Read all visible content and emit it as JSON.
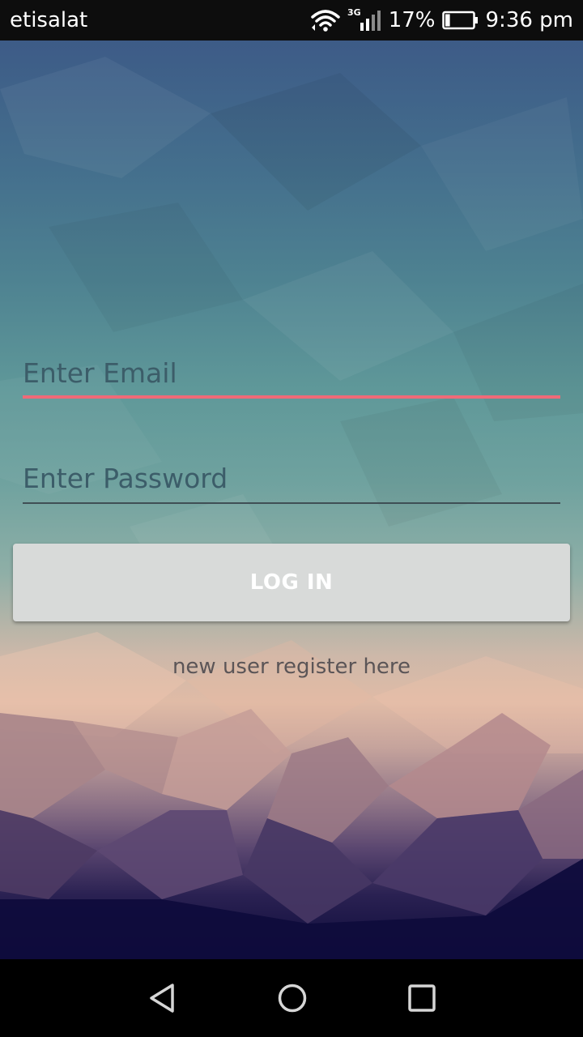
{
  "status_bar": {
    "carrier": "etisalat",
    "network_type": "3G",
    "battery_percent": "17%",
    "battery_level": 0.17,
    "time": "9:36 pm",
    "icons": [
      "wifi-icon",
      "signal-icon",
      "battery-icon"
    ]
  },
  "login_form": {
    "email_placeholder": "Enter Email",
    "email_value": "",
    "password_placeholder": "Enter Password",
    "password_value": "",
    "login_label": "LOG IN",
    "register_link": "new user register here",
    "colors": {
      "email_underline_focused": "#f06a78",
      "password_underline": "#3f4f55",
      "button_bg": "#d8dad9",
      "button_text": "#ffffff"
    }
  },
  "nav_bar": {
    "icons": [
      "back-icon",
      "home-icon",
      "recents-icon"
    ]
  }
}
